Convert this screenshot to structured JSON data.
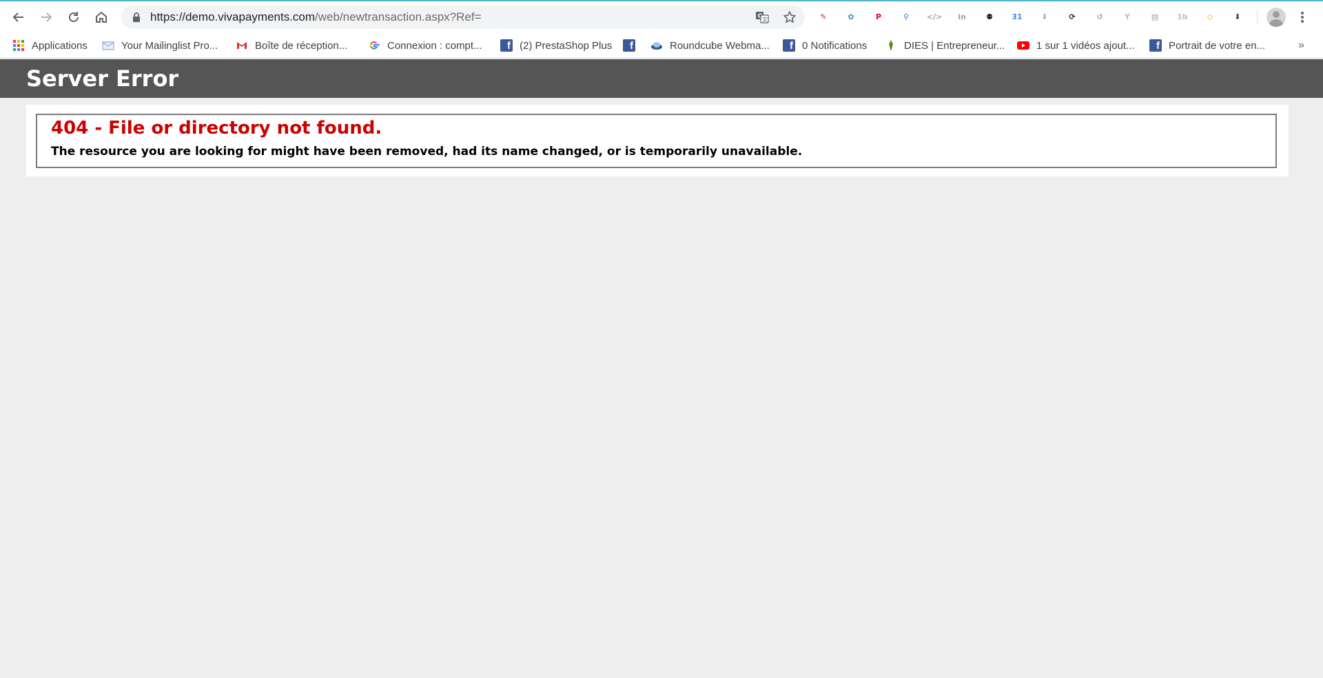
{
  "browser": {
    "url_host": "https://demo.vivapayments.com",
    "url_path": "/web/newtransaction.aspx?Ref=",
    "nav": {
      "back_icon": "back-arrow-icon",
      "forward_icon": "forward-arrow-icon",
      "reload_icon": "reload-icon",
      "home_icon": "home-icon"
    },
    "extensions": [
      {
        "name": "pdf-extension-icon",
        "glyph": "✎",
        "color": "#c62828"
      },
      {
        "name": "shapes-extension-icon",
        "glyph": "✿",
        "color": "#4a86c5"
      },
      {
        "name": "pinterest-extension-icon",
        "glyph": "P",
        "color": "#e60023"
      },
      {
        "name": "magnifier-extension-icon",
        "glyph": "⚲",
        "color": "#1a73e8"
      },
      {
        "name": "code-extension-icon",
        "glyph": "</>",
        "color": "#9e9e9e"
      },
      {
        "name": "linkedin-extension-icon",
        "glyph": "in",
        "color": "#9e9e9e"
      },
      {
        "name": "owl-extension-icon",
        "glyph": "⚉",
        "color": "#222222"
      },
      {
        "name": "calendar-extension-icon",
        "glyph": "31",
        "color": "#4285f4"
      },
      {
        "name": "download-arrow-extension-icon",
        "glyph": "⬇",
        "color": "#9eb3c9"
      },
      {
        "name": "sync-extension-icon",
        "glyph": "⟳",
        "color": "#222222"
      },
      {
        "name": "history-extension-icon",
        "glyph": "↺",
        "color": "#9e9e9e"
      },
      {
        "name": "y-extension-icon",
        "glyph": "Y",
        "color": "#bdbdbd"
      },
      {
        "name": "card-extension-icon",
        "glyph": "▤",
        "color": "#9e9e9e"
      },
      {
        "name": "1b-extension-icon",
        "glyph": "1b",
        "color": "#bdbdbd"
      },
      {
        "name": "diamond-extension-icon",
        "glyph": "◇",
        "color": "#ff9800"
      },
      {
        "name": "download-box-extension-icon",
        "glyph": "⬇",
        "color": "#424242"
      }
    ]
  },
  "bookmarks": [
    {
      "name": "bookmark-applications",
      "label": "Applications",
      "icon": "apps-grid-icon"
    },
    {
      "name": "bookmark-mailinglist",
      "label": "Your Mailinglist Pro...",
      "icon": "envelope-icon"
    },
    {
      "name": "bookmark-gmail",
      "label": "Boîte de réception...",
      "icon": "gmail-icon"
    },
    {
      "name": "bookmark-google",
      "label": "Connexion : compt...",
      "icon": "google-icon"
    },
    {
      "name": "bookmark-prestashop",
      "label": "(2) PrestaShop Plus",
      "icon": "facebook-icon"
    },
    {
      "name": "bookmark-facebook",
      "label": "",
      "icon": "facebook-icon"
    },
    {
      "name": "bookmark-roundcube",
      "label": "Roundcube Webma...",
      "icon": "roundcube-icon"
    },
    {
      "name": "bookmark-notifications",
      "label": "0 Notifications",
      "icon": "facebook-icon"
    },
    {
      "name": "bookmark-dies",
      "label": "DIES | Entrepreneur...",
      "icon": "leaf-icon"
    },
    {
      "name": "bookmark-youtube",
      "label": "1 sur 1 vidéos ajout...",
      "icon": "youtube-icon"
    },
    {
      "name": "bookmark-portrait",
      "label": "Portrait de votre en...",
      "icon": "facebook-icon"
    }
  ],
  "bookmarks_overflow": "»",
  "page": {
    "header_title": "Server Error",
    "error_title": "404 - File or directory not found.",
    "error_message": "The resource you are looking for might have been removed, had its name changed, or is temporarily unavailable."
  },
  "colors": {
    "header_bg": "#555555",
    "error_red": "#cc0000",
    "page_bg": "#eeeeee"
  }
}
